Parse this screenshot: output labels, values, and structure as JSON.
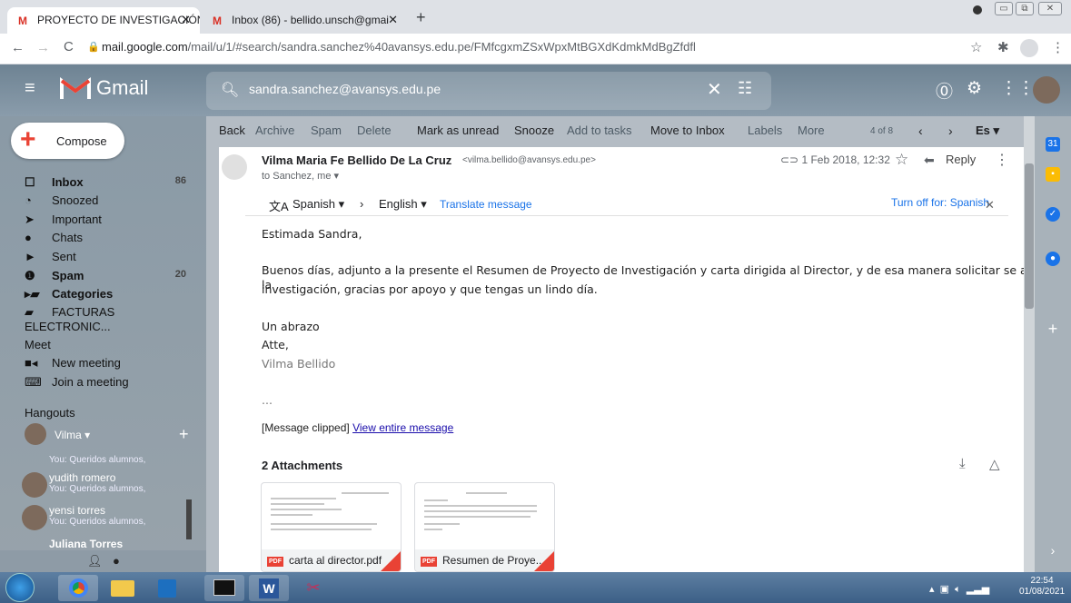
{
  "browser": {
    "tabs": [
      {
        "title": "PROYECTO DE INVESTIGACIÓN -"
      },
      {
        "title": "Inbox (86) - bellido.unsch@gmai"
      }
    ],
    "url_host": "mail.google.com",
    "url_path": "/mail/u/1/#search/sandra.sanchez%40avansys.edu.pe/FMfcgxmZSxWpxMtBGXdKdmkMdBgZfdfl"
  },
  "gmail": {
    "logo_text": "Gmail",
    "search_value": "sandra.sanchez@avansys.edu.pe"
  },
  "sidebar": {
    "compose": "Compose",
    "items": [
      {
        "label": "Inbox",
        "count": "86",
        "icon": "inbox-icon"
      },
      {
        "label": "Snoozed",
        "count": "",
        "icon": "clock-icon"
      },
      {
        "label": "Important",
        "count": "",
        "icon": "important-icon"
      },
      {
        "label": "Chats",
        "count": "",
        "icon": "chat-icon"
      },
      {
        "label": "Sent",
        "count": "",
        "icon": "send-icon"
      },
      {
        "label": "Spam",
        "count": "20",
        "icon": "spam-icon"
      },
      {
        "label": "Categories",
        "count": "",
        "icon": "label-icon"
      },
      {
        "label": "FACTURAS ELECTRONIC...",
        "count": "",
        "icon": "label-icon"
      }
    ],
    "meet_title": "Meet",
    "meet_items": [
      "New meeting",
      "Join a meeting"
    ],
    "hangouts_title": "Hangouts",
    "hangouts_user": "Vilma",
    "conversations": [
      {
        "name": "",
        "snippet": "You:  Queridos alumnos,"
      },
      {
        "name": "yudith romero",
        "snippet": "You:  Queridos alumnos,"
      },
      {
        "name": "yensi torres",
        "snippet": "You:  Queridos alumnos,"
      },
      {
        "name": "Juliana Torres",
        "snippet": ""
      }
    ]
  },
  "toolbar": {
    "actions": [
      "Back",
      "Archive",
      "Spam",
      "Delete",
      "Mark as unread",
      "Snooze",
      "Add to tasks",
      "Move to Inbox",
      "Labels",
      "More"
    ],
    "pager": "4 of 8",
    "lang": "Es"
  },
  "message": {
    "sender_name": "Vilma Maria Fe Bellido De La Cruz",
    "sender_email": "<vilma.bellido@avansys.edu.pe>",
    "to": "to Sanchez, me",
    "date": "1 Feb 2018, 12:32",
    "reply": "Reply",
    "translate_from": "Spanish",
    "translate_to": "English",
    "translate_link": "Translate message",
    "turn_off": "Turn off for: Spanish",
    "greeting": "Estimada Sandra,",
    "para1_line1": "Buenos días, adjunto a la presente el Resumen de Proyecto de Investigación y carta dirigida al Director, y de esa manera solicitar se autorice la",
    "para1_line2": "investigación, gracias por apoyo y que tengas un lindo día.",
    "closing1": "Un abrazo",
    "closing2": "Atte,",
    "signature": "Vilma Bellido",
    "ellipsis": "...",
    "clipped": "[Message clipped]",
    "view_entire": "View entire message",
    "attachments_title": "2 Attachments",
    "attachments": [
      {
        "name": "carta al director.pdf"
      },
      {
        "name": "Resumen de Proye..."
      }
    ]
  },
  "taskbar": {
    "time": "22:54",
    "date": "01/08/2021"
  }
}
